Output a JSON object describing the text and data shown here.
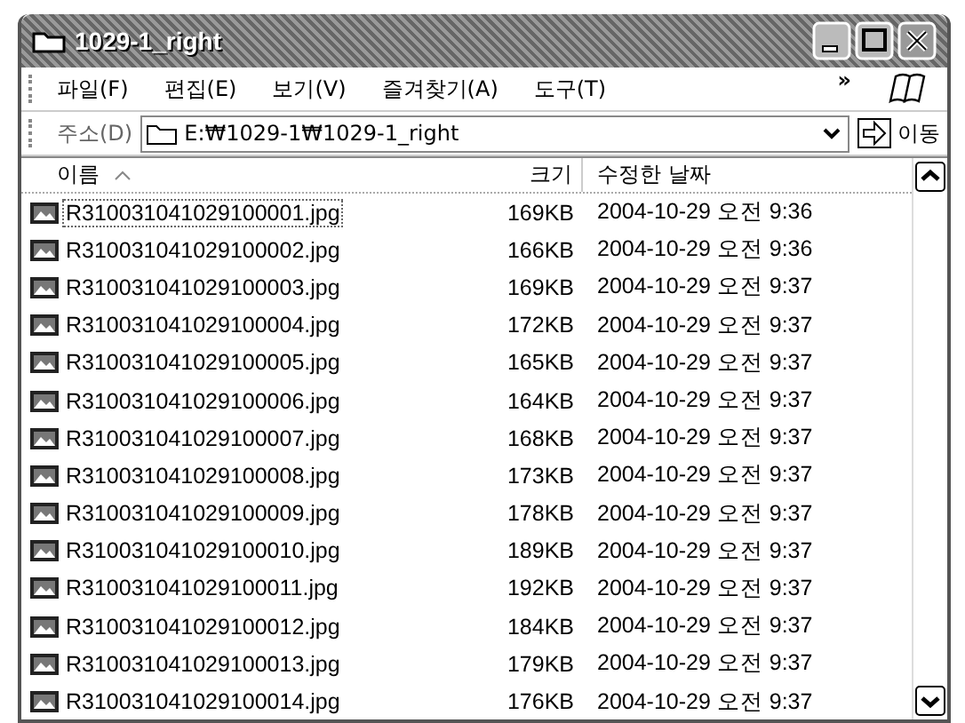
{
  "window": {
    "title": "1029-1_right"
  },
  "menu": {
    "items": [
      "파일(F)",
      "편집(E)",
      "보기(V)",
      "즐겨찾기(A)",
      "도구(T)"
    ],
    "overflow": "»"
  },
  "address": {
    "label": "주소(D)",
    "value": "E:₩1029-1₩1029-1_right",
    "go": "이동"
  },
  "columns": [
    {
      "label": "이름",
      "sorted": true
    },
    {
      "label": "크기",
      "sorted": false
    },
    {
      "label": "수정한 날짜",
      "sorted": false
    }
  ],
  "rows": [
    {
      "name": "R310031041029100001.jpg",
      "size": "169KB",
      "modified": "2004-10-29 오전 9:36",
      "focused": true
    },
    {
      "name": "R310031041029100002.jpg",
      "size": "166KB",
      "modified": "2004-10-29 오전 9:36",
      "focused": false
    },
    {
      "name": "R310031041029100003.jpg",
      "size": "169KB",
      "modified": "2004-10-29 오전 9:37",
      "focused": false
    },
    {
      "name": "R310031041029100004.jpg",
      "size": "172KB",
      "modified": "2004-10-29 오전 9:37",
      "focused": false
    },
    {
      "name": "R310031041029100005.jpg",
      "size": "165KB",
      "modified": "2004-10-29 오전 9:37",
      "focused": false
    },
    {
      "name": "R310031041029100006.jpg",
      "size": "164KB",
      "modified": "2004-10-29 오전 9:37",
      "focused": false
    },
    {
      "name": "R310031041029100007.jpg",
      "size": "168KB",
      "modified": "2004-10-29 오전 9:37",
      "focused": false
    },
    {
      "name": "R310031041029100008.jpg",
      "size": "173KB",
      "modified": "2004-10-29 오전 9:37",
      "focused": false
    },
    {
      "name": "R310031041029100009.jpg",
      "size": "178KB",
      "modified": "2004-10-29 오전 9:37",
      "focused": false
    },
    {
      "name": "R310031041029100010.jpg",
      "size": "189KB",
      "modified": "2004-10-29 오전 9:37",
      "focused": false
    },
    {
      "name": "R310031041029100011.jpg",
      "size": "192KB",
      "modified": "2004-10-29 오전 9:37",
      "focused": false
    },
    {
      "name": "R310031041029100012.jpg",
      "size": "184KB",
      "modified": "2004-10-29 오전 9:37",
      "focused": false
    },
    {
      "name": "R310031041029100013.jpg",
      "size": "179KB",
      "modified": "2004-10-29 오전 9:37",
      "focused": false
    },
    {
      "name": "R310031041029100014.jpg",
      "size": "176KB",
      "modified": "2004-10-29 오전 9:37",
      "focused": false
    }
  ]
}
